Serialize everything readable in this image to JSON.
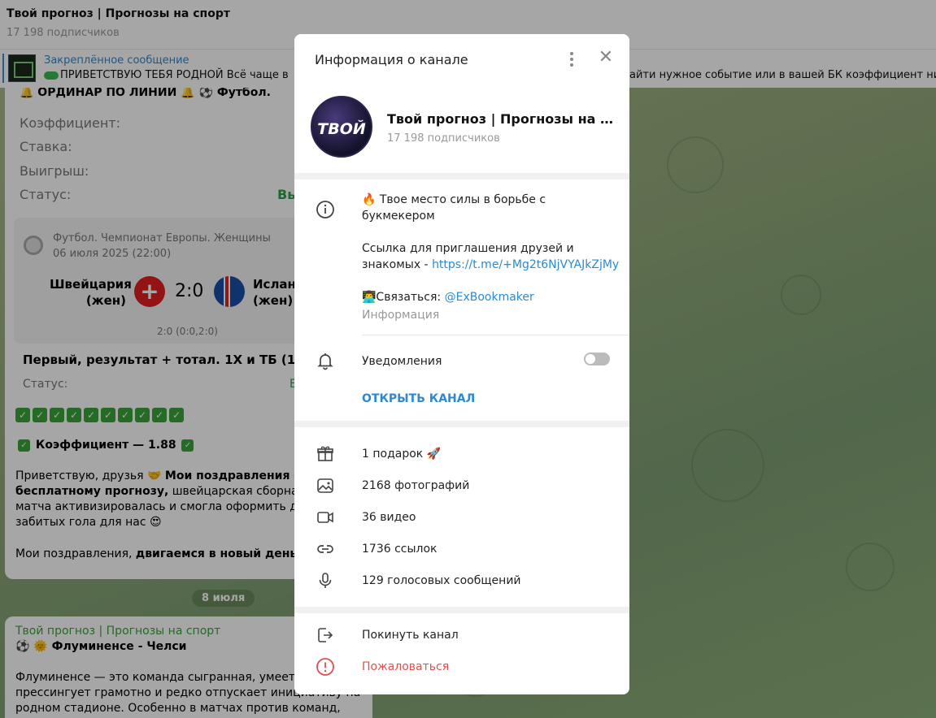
{
  "header": {
    "title": "Твой прогноз | Прогнозы на спорт",
    "subscribers": "17 198 подписчиков"
  },
  "pinned": {
    "title": "Закреплённое сообщение",
    "text": "ПРИВЕТСТВУЮ ТЕБЯ РОДНОЙ Всё чаще в",
    "text_right": "айти нужное событие или в вашей БК коэффициент ни"
  },
  "chat": {
    "top_line": "🔔 ОРДИНАР ПО ЛИНИИ 🔔 ⚽ Футбол.",
    "rows": [
      {
        "label": "Коэффициент:"
      },
      {
        "label": "Ставка:"
      },
      {
        "label": "Выигрыш:"
      },
      {
        "label": "Статус:",
        "value": "Вы"
      }
    ],
    "match": {
      "league": "Футбол. Чемпионат Европы. Женщины",
      "datetime": "06 июля 2025 (22:00)",
      "team1": "Швейцария",
      "team1_sub": "(жен)",
      "score": "2:0",
      "team2": "Исланд",
      "team2_sub": "(жен)",
      "halves": "2:0 (0:0,2:0)"
    },
    "bet": "Первый, результат + тотал. 1Х и ТБ (1.5) -",
    "status_label": "Статус:",
    "status_value": "В",
    "checkmark": "✓",
    "coef_line": "Коэффициент — 1.88",
    "p1_a": "Приветствую, друзья 🤝 ",
    "p1_b": "Мои поздравления с по",
    "p2_a": "бесплатному прогнозу,",
    "p2_b": " швейцарская сборная пе",
    "p3": "матча активизировалась и смогла оформить два",
    "p4": "забитых гола для нас 😍",
    "p5_a": "Мои поздравления, ",
    "p5_b": "двигаемся в новый день 💪",
    "date_badge": "8 июля",
    "post2_author": "Твой прогноз | Прогнозы на спорт",
    "post2_title": "⚽ 🌞 Флуминенсе - Челси",
    "post2_p1": "Флуминенсе —  это команда сыгранная, умеет де",
    "post2_p2": "прессингует грамотно и редко отпускает инициативу на",
    "post2_p3": "родном стадионе. Особенно в матчах против команд,"
  },
  "modal": {
    "title": "Информация о канале",
    "channel_name": "Твой прогноз | Прогнозы на с...",
    "channel_subs": "17 198 подписчиков",
    "avatar_text": "ТВОЙ",
    "desc1": "🔥 Твое место силы в борьбе с",
    "desc2": "букмекером",
    "desc3": "Ссылка для приглашения друзей и",
    "desc4_a": "знакомых - ",
    "desc4_link": "https://t.me/+Mg2t6NjVYAJkZjMy",
    "desc5_a": "👨‍💻Связаться: ",
    "desc5_link": "@ExBookmaker",
    "desc_label": "Информация",
    "notifications": "Уведомления",
    "open_channel": "ОТКРЫТЬ КАНАЛ",
    "stats": [
      {
        "text": "1 подарок 🚀",
        "icon": "gift-icon"
      },
      {
        "text": "2168 фотографий",
        "icon": "photo-icon"
      },
      {
        "text": "36 видео",
        "icon": "video-icon"
      },
      {
        "text": "1736 ссылок",
        "icon": "link-icon"
      },
      {
        "text": "129 голосовых сообщений",
        "icon": "mic-icon"
      }
    ],
    "leave": "Покинуть канал",
    "report": "Пожаловаться"
  }
}
